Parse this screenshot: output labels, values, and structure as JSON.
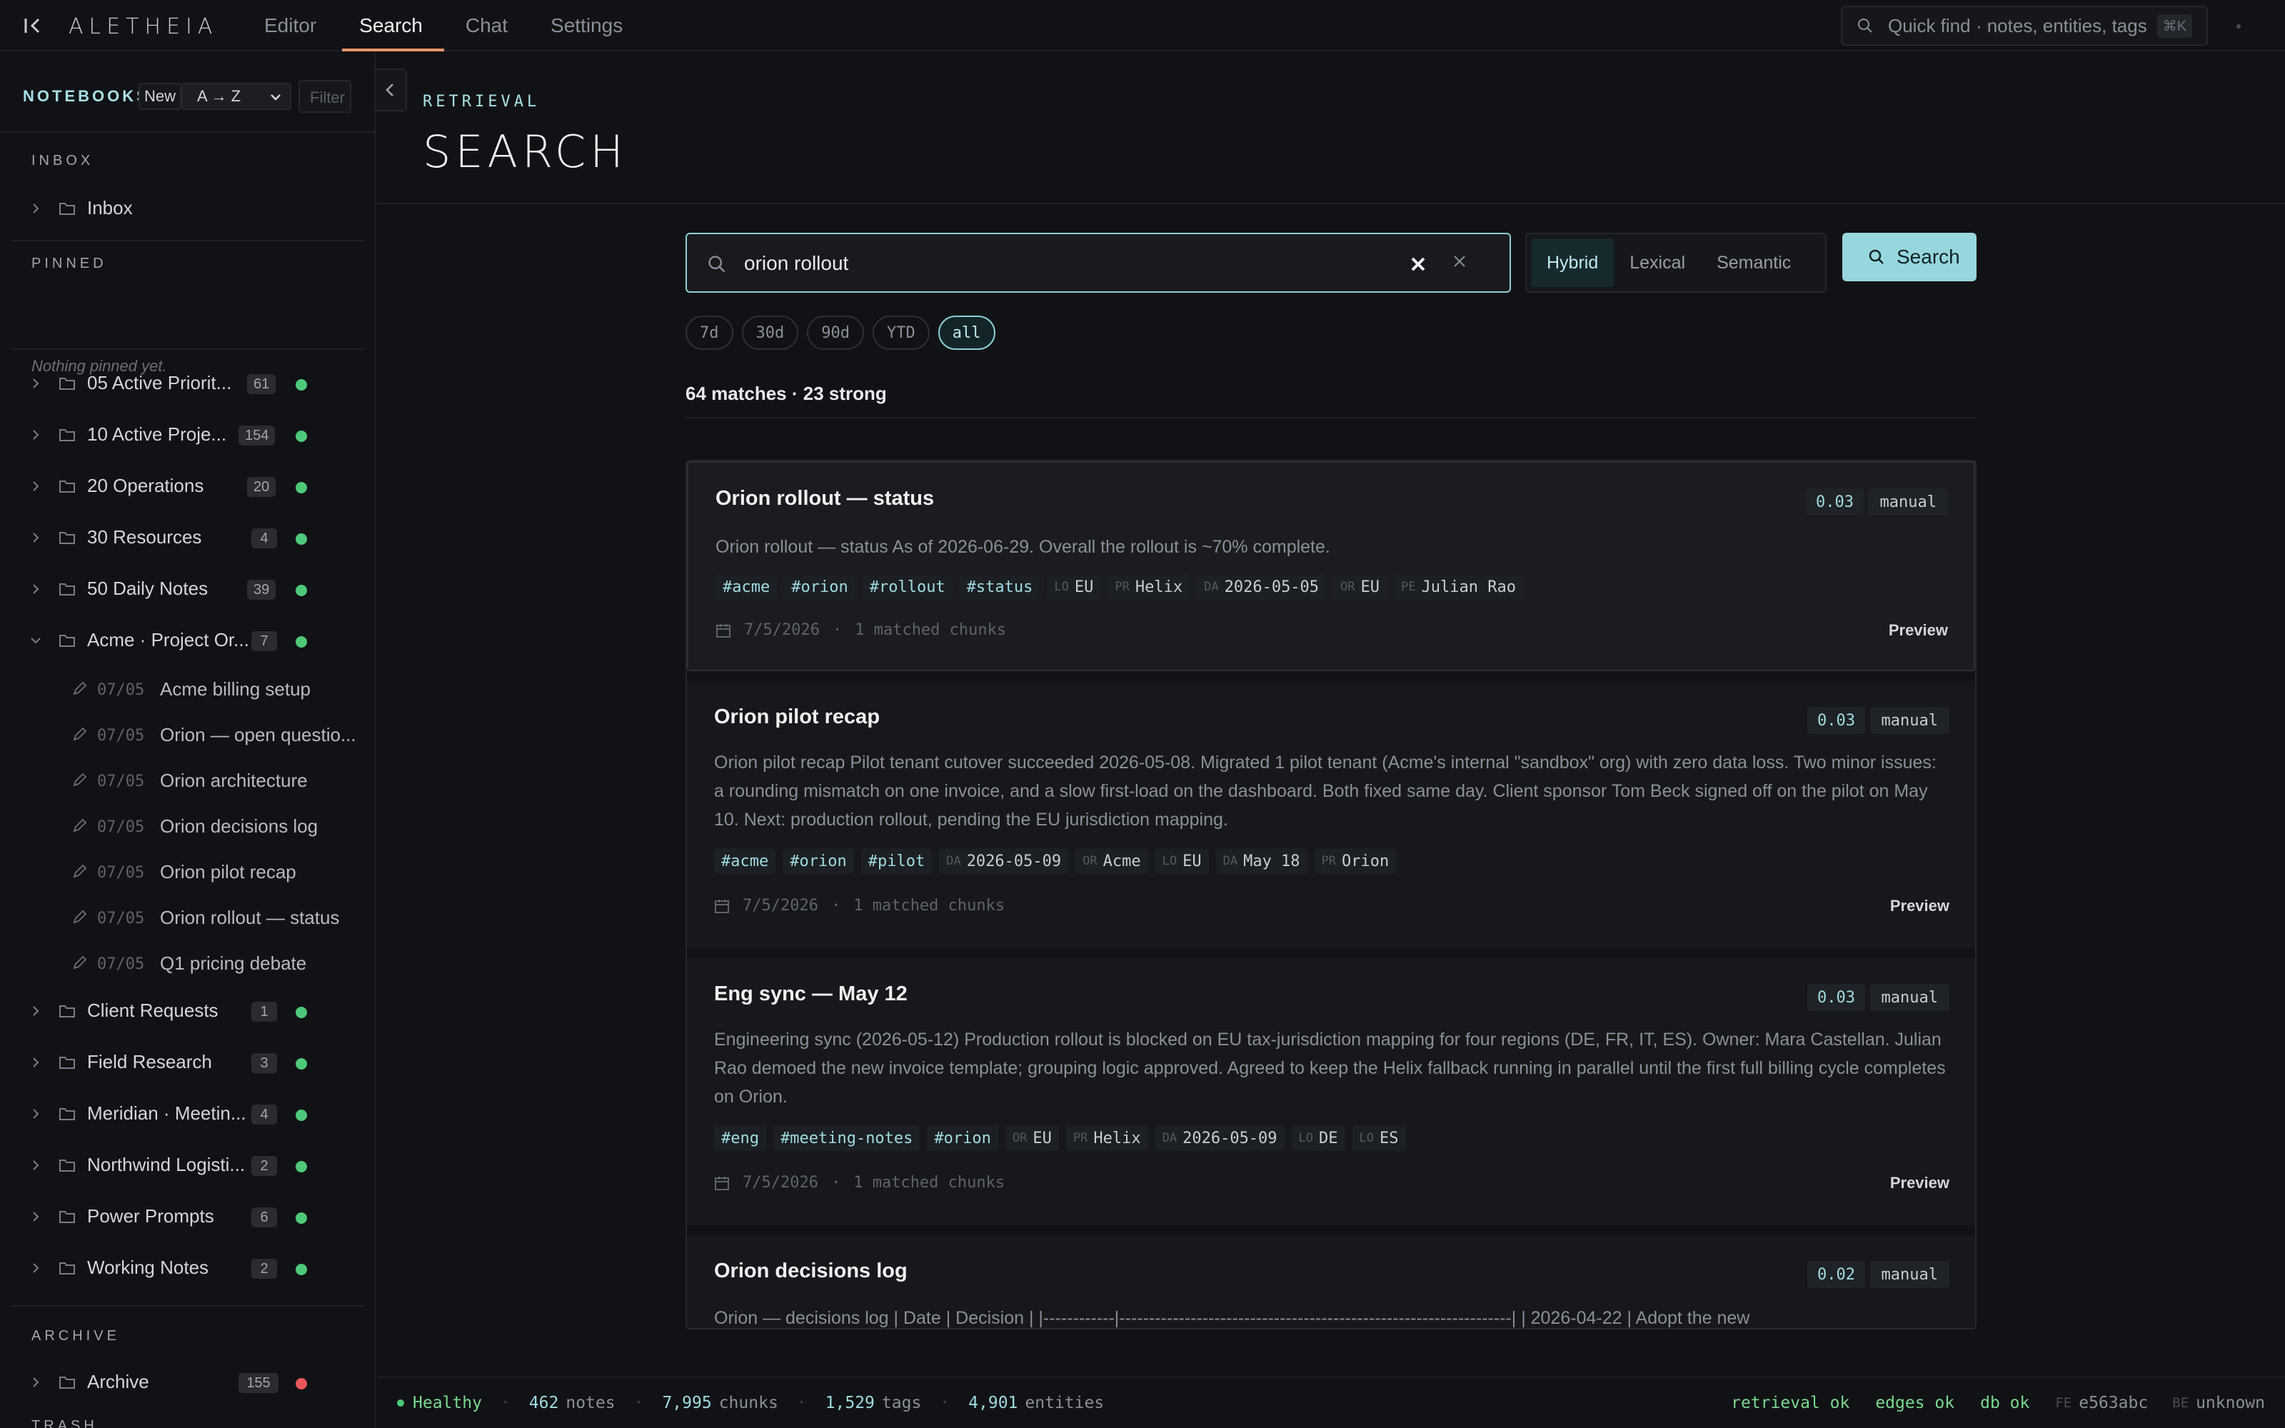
{
  "app": {
    "brand": "ALETHEIA"
  },
  "nav": {
    "tabs": [
      {
        "label": "Editor",
        "active": false
      },
      {
        "label": "Search",
        "active": true
      },
      {
        "label": "Chat",
        "active": false
      },
      {
        "label": "Settings",
        "active": false
      }
    ]
  },
  "quickfind": {
    "placeholder": "Quick find · notes, entities, tags",
    "shortcut": "⌘K"
  },
  "sidebar": {
    "title": "NOTEBOOKS",
    "new_label": "New",
    "sort_value": "A → Z",
    "filter_placeholder": "Filter",
    "sections": {
      "inbox": "INBOX",
      "pinned": "PINNED",
      "archive": "ARCHIVE",
      "trash": "TRASH"
    },
    "nothing_pinned": "Nothing pinned yet.",
    "inbox": {
      "label": "Inbox"
    },
    "notebooks": [
      {
        "label": "05 Active Priorit...",
        "count": "61"
      },
      {
        "label": "10 Active Proje...",
        "count": "154"
      },
      {
        "label": "20 Operations",
        "count": "20"
      },
      {
        "label": "30 Resources",
        "count": "4"
      },
      {
        "label": "50 Daily Notes",
        "count": "39"
      },
      {
        "label": "Acme · Project Or...",
        "count": "7"
      }
    ],
    "notes": [
      {
        "date": "07/05",
        "title": "Acme billing setup"
      },
      {
        "date": "07/05",
        "title": "Orion — open questio..."
      },
      {
        "date": "07/05",
        "title": "Orion architecture"
      },
      {
        "date": "07/05",
        "title": "Orion decisions log"
      },
      {
        "date": "07/05",
        "title": "Orion pilot recap"
      },
      {
        "date": "07/05",
        "title": "Orion rollout — status"
      },
      {
        "date": "07/05",
        "title": "Q1 pricing debate"
      }
    ],
    "notebooks2": [
      {
        "label": "Client Requests",
        "count": "1"
      },
      {
        "label": "Field Research",
        "count": "3"
      },
      {
        "label": "Meridian · Meetin...",
        "count": "4"
      },
      {
        "label": "Northwind Logisti...",
        "count": "2"
      },
      {
        "label": "Power Prompts",
        "count": "6"
      },
      {
        "label": "Working Notes",
        "count": "2"
      }
    ],
    "archive": {
      "label": "Archive",
      "count": "155"
    }
  },
  "page": {
    "eyebrow": "RETRIEVAL",
    "title": "SEARCH"
  },
  "search": {
    "query": "orion rollout",
    "modes": [
      "Hybrid",
      "Lexical",
      "Semantic"
    ],
    "active_mode": "Hybrid",
    "button_label": "Search",
    "ranges": [
      "7d",
      "30d",
      "90d",
      "YTD",
      "all"
    ],
    "active_range": "all",
    "summary": "64 matches · 23 strong"
  },
  "results": [
    {
      "title": "Orion rollout — status",
      "score": "0.03",
      "source": "manual",
      "snippet": "Orion rollout — status As of 2026-06-29. Overall the rollout is ~70% complete.",
      "tags": [
        "#acme",
        "#orion",
        "#rollout",
        "#status"
      ],
      "entities": [
        {
          "k": "LO",
          "v": "EU"
        },
        {
          "k": "PR",
          "v": "Helix"
        },
        {
          "k": "DA",
          "v": "2026-05-05"
        },
        {
          "k": "OR",
          "v": "EU"
        },
        {
          "k": "PE",
          "v": "Julian Rao"
        }
      ],
      "date": "7/5/2026",
      "chunks": "1 matched chunks",
      "preview": "Preview"
    },
    {
      "title": "Orion pilot recap",
      "score": "0.03",
      "source": "manual",
      "snippet": "Orion pilot recap Pilot tenant cutover succeeded 2026-05-08. Migrated 1 pilot tenant (Acme's internal \"sandbox\" org) with zero data loss. Two minor issues: a rounding mismatch on one invoice, and a slow first-load on the dashboard. Both fixed same day. Client sponsor Tom Beck signed off on the pilot on May 10. Next: production rollout, pending the EU jurisdiction mapping.",
      "tags": [
        "#acme",
        "#orion",
        "#pilot"
      ],
      "entities": [
        {
          "k": "DA",
          "v": "2026-05-09"
        },
        {
          "k": "OR",
          "v": "Acme"
        },
        {
          "k": "LO",
          "v": "EU"
        },
        {
          "k": "DA",
          "v": "May 18"
        },
        {
          "k": "PR",
          "v": "Orion"
        }
      ],
      "date": "7/5/2026",
      "chunks": "1 matched chunks",
      "preview": "Preview"
    },
    {
      "title": "Eng sync — May 12",
      "score": "0.03",
      "source": "manual",
      "snippet": "Engineering sync (2026-05-12) Production rollout is blocked on EU tax-jurisdiction mapping for four regions (DE, FR, IT, ES). Owner: Mara Castellan. Julian Rao demoed the new invoice template; grouping logic approved. Agreed to keep the Helix fallback running in parallel until the first full billing cycle completes on Orion.",
      "tags": [
        "#eng",
        "#meeting-notes",
        "#orion"
      ],
      "entities": [
        {
          "k": "OR",
          "v": "EU"
        },
        {
          "k": "PR",
          "v": "Helix"
        },
        {
          "k": "DA",
          "v": "2026-05-09"
        },
        {
          "k": "LO",
          "v": "DE"
        },
        {
          "k": "LO",
          "v": "ES"
        }
      ],
      "date": "7/5/2026",
      "chunks": "1 matched chunks",
      "preview": "Preview"
    },
    {
      "title": "Orion decisions log",
      "score": "0.02",
      "source": "manual",
      "snippet": "Orion — decisions log | Date | Decision | |------------|------------------------------------------------------------------| | 2026-04-22 | Adopt the new"
    }
  ],
  "status": {
    "health": "Healthy",
    "notes_n": "462",
    "notes_l": "notes",
    "chunks_n": "7,995",
    "chunks_l": "chunks",
    "tags_n": "1,529",
    "tags_l": "tags",
    "entities_n": "4,901",
    "entities_l": "entities",
    "checks": [
      "retrieval ok",
      "edges ok",
      "db ok"
    ],
    "fe_k": "FE",
    "fe_v": "e563abc",
    "be_k": "BE",
    "be_v": "unknown"
  },
  "colors": {
    "accent": "#97d6dc",
    "tab_underline": "#e8956a",
    "ok": "#4ec97a",
    "error": "#e8575a"
  }
}
